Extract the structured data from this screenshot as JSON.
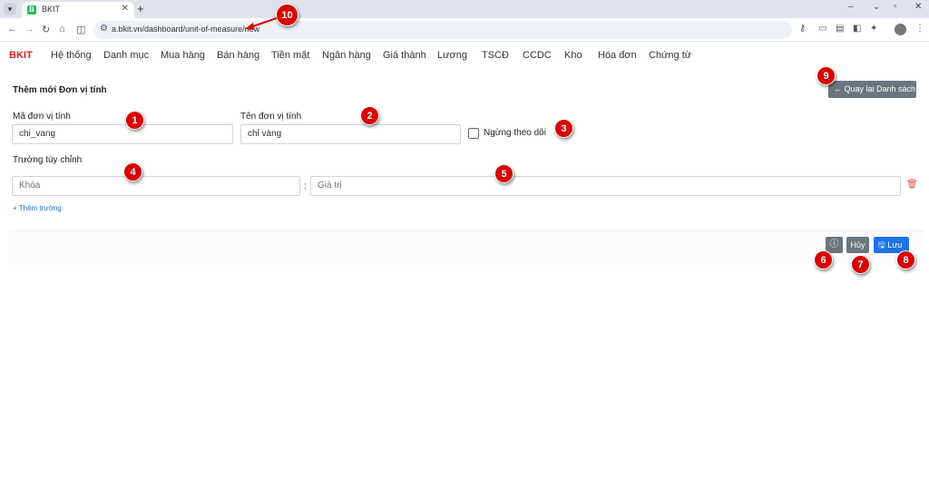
{
  "browser": {
    "tab_title": "BKIT",
    "tab_favicon": "B",
    "url": "a.bkit.vn/dashboard/unit-of-measure/new"
  },
  "app": {
    "brand": "BKIT",
    "menu": [
      "Hệ thống",
      "Danh mục",
      "Mua hàng",
      "Bán hàng",
      "Tiền mặt",
      "Ngân hàng",
      "Giá thành",
      "Lương",
      "TSCĐ",
      "CCDC",
      "Kho",
      "Hóa đơn",
      "Chứng từ"
    ]
  },
  "form": {
    "title": "Thêm mới Đơn vị tính",
    "back_label": "Quay lại Danh sách",
    "code_label": "Mã đơn vị tính",
    "code_value": "chi_vang",
    "name_label": "Tên đơn vị tính",
    "name_value": "chỉ vàng",
    "inactive_label": "Ngừng theo dõi",
    "inactive_checked": false,
    "custom_section": "Trường tùy chỉnh",
    "key_placeholder": "Khóa",
    "value_placeholder": "Giá trị",
    "add_field": "Thêm trường",
    "cancel_label": "Hủy",
    "save_label": "Lưu"
  },
  "markers": [
    "1",
    "2",
    "3",
    "4",
    "5",
    "6",
    "7",
    "8",
    "9",
    "10"
  ],
  "colors": {
    "brand": "#e02020",
    "primary": "#1a73e8",
    "secondary": "#6c757d",
    "marker": "#d80000"
  }
}
